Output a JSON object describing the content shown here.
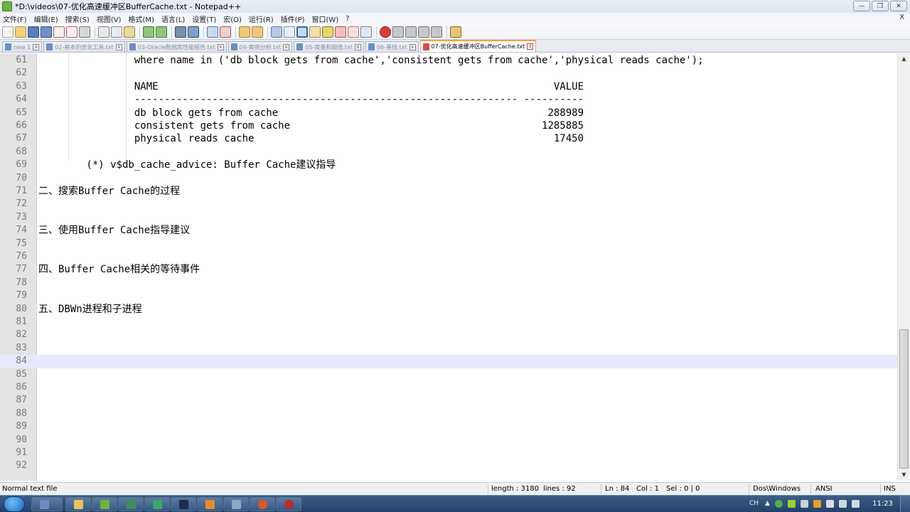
{
  "window": {
    "title": "*D:\\videos\\07-优化高速缓冲区BufferCache.txt - Notepad++"
  },
  "menu": {
    "items": [
      "文件(F)",
      "编辑(E)",
      "搜索(S)",
      "视图(V)",
      "格式(M)",
      "语言(L)",
      "设置(T)",
      "宏(O)",
      "运行(R)",
      "插件(P)",
      "窗口(W)",
      "?"
    ],
    "close_label": "X"
  },
  "tabs": [
    {
      "label": "new 1"
    },
    {
      "label": "02-基本的优化工具.txt"
    },
    {
      "label": "03-Oracle数据库性能报告.txt"
    },
    {
      "label": "04-案例分析.txt"
    },
    {
      "label": "05-度量和阈值.txt"
    },
    {
      "label": "06-基线.txt"
    },
    {
      "label": "07-优化高速缓冲区BufferCache.txt"
    }
  ],
  "active_tab_index": 6,
  "editor": {
    "current_line": 84,
    "lines": [
      {
        "num": "61",
        "text": "                where name in ('db block gets from cache','consistent gets from cache','physical reads cache');"
      },
      {
        "num": "62",
        "text": ""
      },
      {
        "num": "63",
        "text": "                NAME                                                                  VALUE"
      },
      {
        "num": "64",
        "text": "                ---------------------------------------------------------------- ----------"
      },
      {
        "num": "65",
        "text": "                db block gets from cache                                             288989"
      },
      {
        "num": "66",
        "text": "                consistent gets from cache                                          1285885"
      },
      {
        "num": "67",
        "text": "                physical reads cache                                                  17450"
      },
      {
        "num": "68",
        "text": ""
      },
      {
        "num": "69",
        "text": "        (*) v$db_cache_advice: Buffer Cache建议指导"
      },
      {
        "num": "70",
        "text": ""
      },
      {
        "num": "71",
        "text": "二、搜索Buffer Cache的过程"
      },
      {
        "num": "72",
        "text": ""
      },
      {
        "num": "73",
        "text": ""
      },
      {
        "num": "74",
        "text": "三、使用Buffer Cache指导建议"
      },
      {
        "num": "75",
        "text": ""
      },
      {
        "num": "76",
        "text": ""
      },
      {
        "num": "77",
        "text": "四、Buffer Cache相关的等待事件"
      },
      {
        "num": "78",
        "text": ""
      },
      {
        "num": "79",
        "text": ""
      },
      {
        "num": "80",
        "text": "五、DBWn进程和子进程"
      },
      {
        "num": "81",
        "text": ""
      },
      {
        "num": "82",
        "text": ""
      },
      {
        "num": "83",
        "text": ""
      },
      {
        "num": "84",
        "text": ""
      },
      {
        "num": "85",
        "text": ""
      },
      {
        "num": "86",
        "text": ""
      },
      {
        "num": "87",
        "text": ""
      },
      {
        "num": "88",
        "text": ""
      },
      {
        "num": "89",
        "text": ""
      },
      {
        "num": "90",
        "text": ""
      },
      {
        "num": "91",
        "text": ""
      },
      {
        "num": "92",
        "text": ""
      }
    ]
  },
  "status": {
    "file_type": "Normal text file",
    "length": "length : 3180",
    "lines": "lines : 92",
    "ln": "Ln : 84",
    "col": "Col : 1",
    "sel": "Sel : 0 | 0",
    "eol": "Dos\\Windows",
    "encoding": "ANSI",
    "mode": "INS"
  },
  "taskbar": {
    "tray_lang": "CH",
    "clock": "11:23"
  },
  "colors": {
    "tab_accent": "#f7a33a",
    "current_line_bg": "#e8e8ff",
    "gutter_bg": "#e4e4e4"
  }
}
